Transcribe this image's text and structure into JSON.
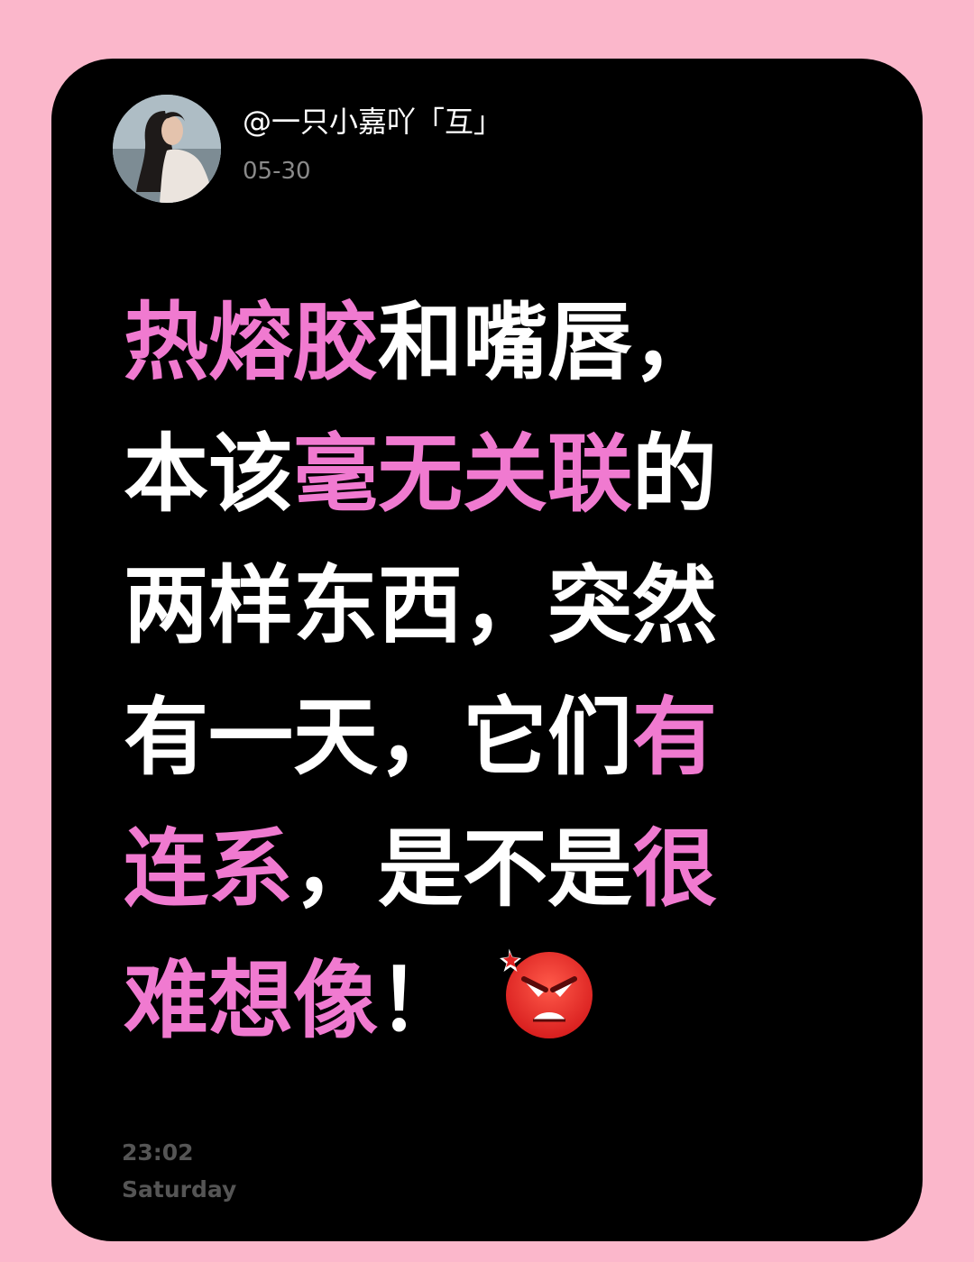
{
  "post": {
    "username": "@一只小嘉吖「互」",
    "date": "05-30",
    "lines": [
      [
        {
          "text": "热熔胶",
          "highlight": true
        },
        {
          "text": "和嘴唇，",
          "highlight": false
        }
      ],
      [
        {
          "text": "本该",
          "highlight": false
        },
        {
          "text": "毫无关联",
          "highlight": true
        },
        {
          "text": "的",
          "highlight": false
        }
      ],
      [
        {
          "text": "两样东西，突然",
          "highlight": false
        }
      ],
      [
        {
          "text": "有一天，它们",
          "highlight": false
        },
        {
          "text": "有",
          "highlight": true
        }
      ],
      [
        {
          "text": "连系",
          "highlight": true
        },
        {
          "text": "，是不是",
          "highlight": false
        },
        {
          "text": "很",
          "highlight": true
        }
      ],
      [
        {
          "text": "难想像",
          "highlight": true
        },
        {
          "text": "！",
          "highlight": false
        }
      ]
    ],
    "emoji": "angry-face-emoji",
    "time": "23:02",
    "weekday": "Saturday"
  },
  "colors": {
    "page_background": "#fbb7cb",
    "card_background": "#000000",
    "text": "#ffffff",
    "highlight": "#f07ad0",
    "date_text": "#8a8a8a",
    "footer_text": "#555555"
  }
}
